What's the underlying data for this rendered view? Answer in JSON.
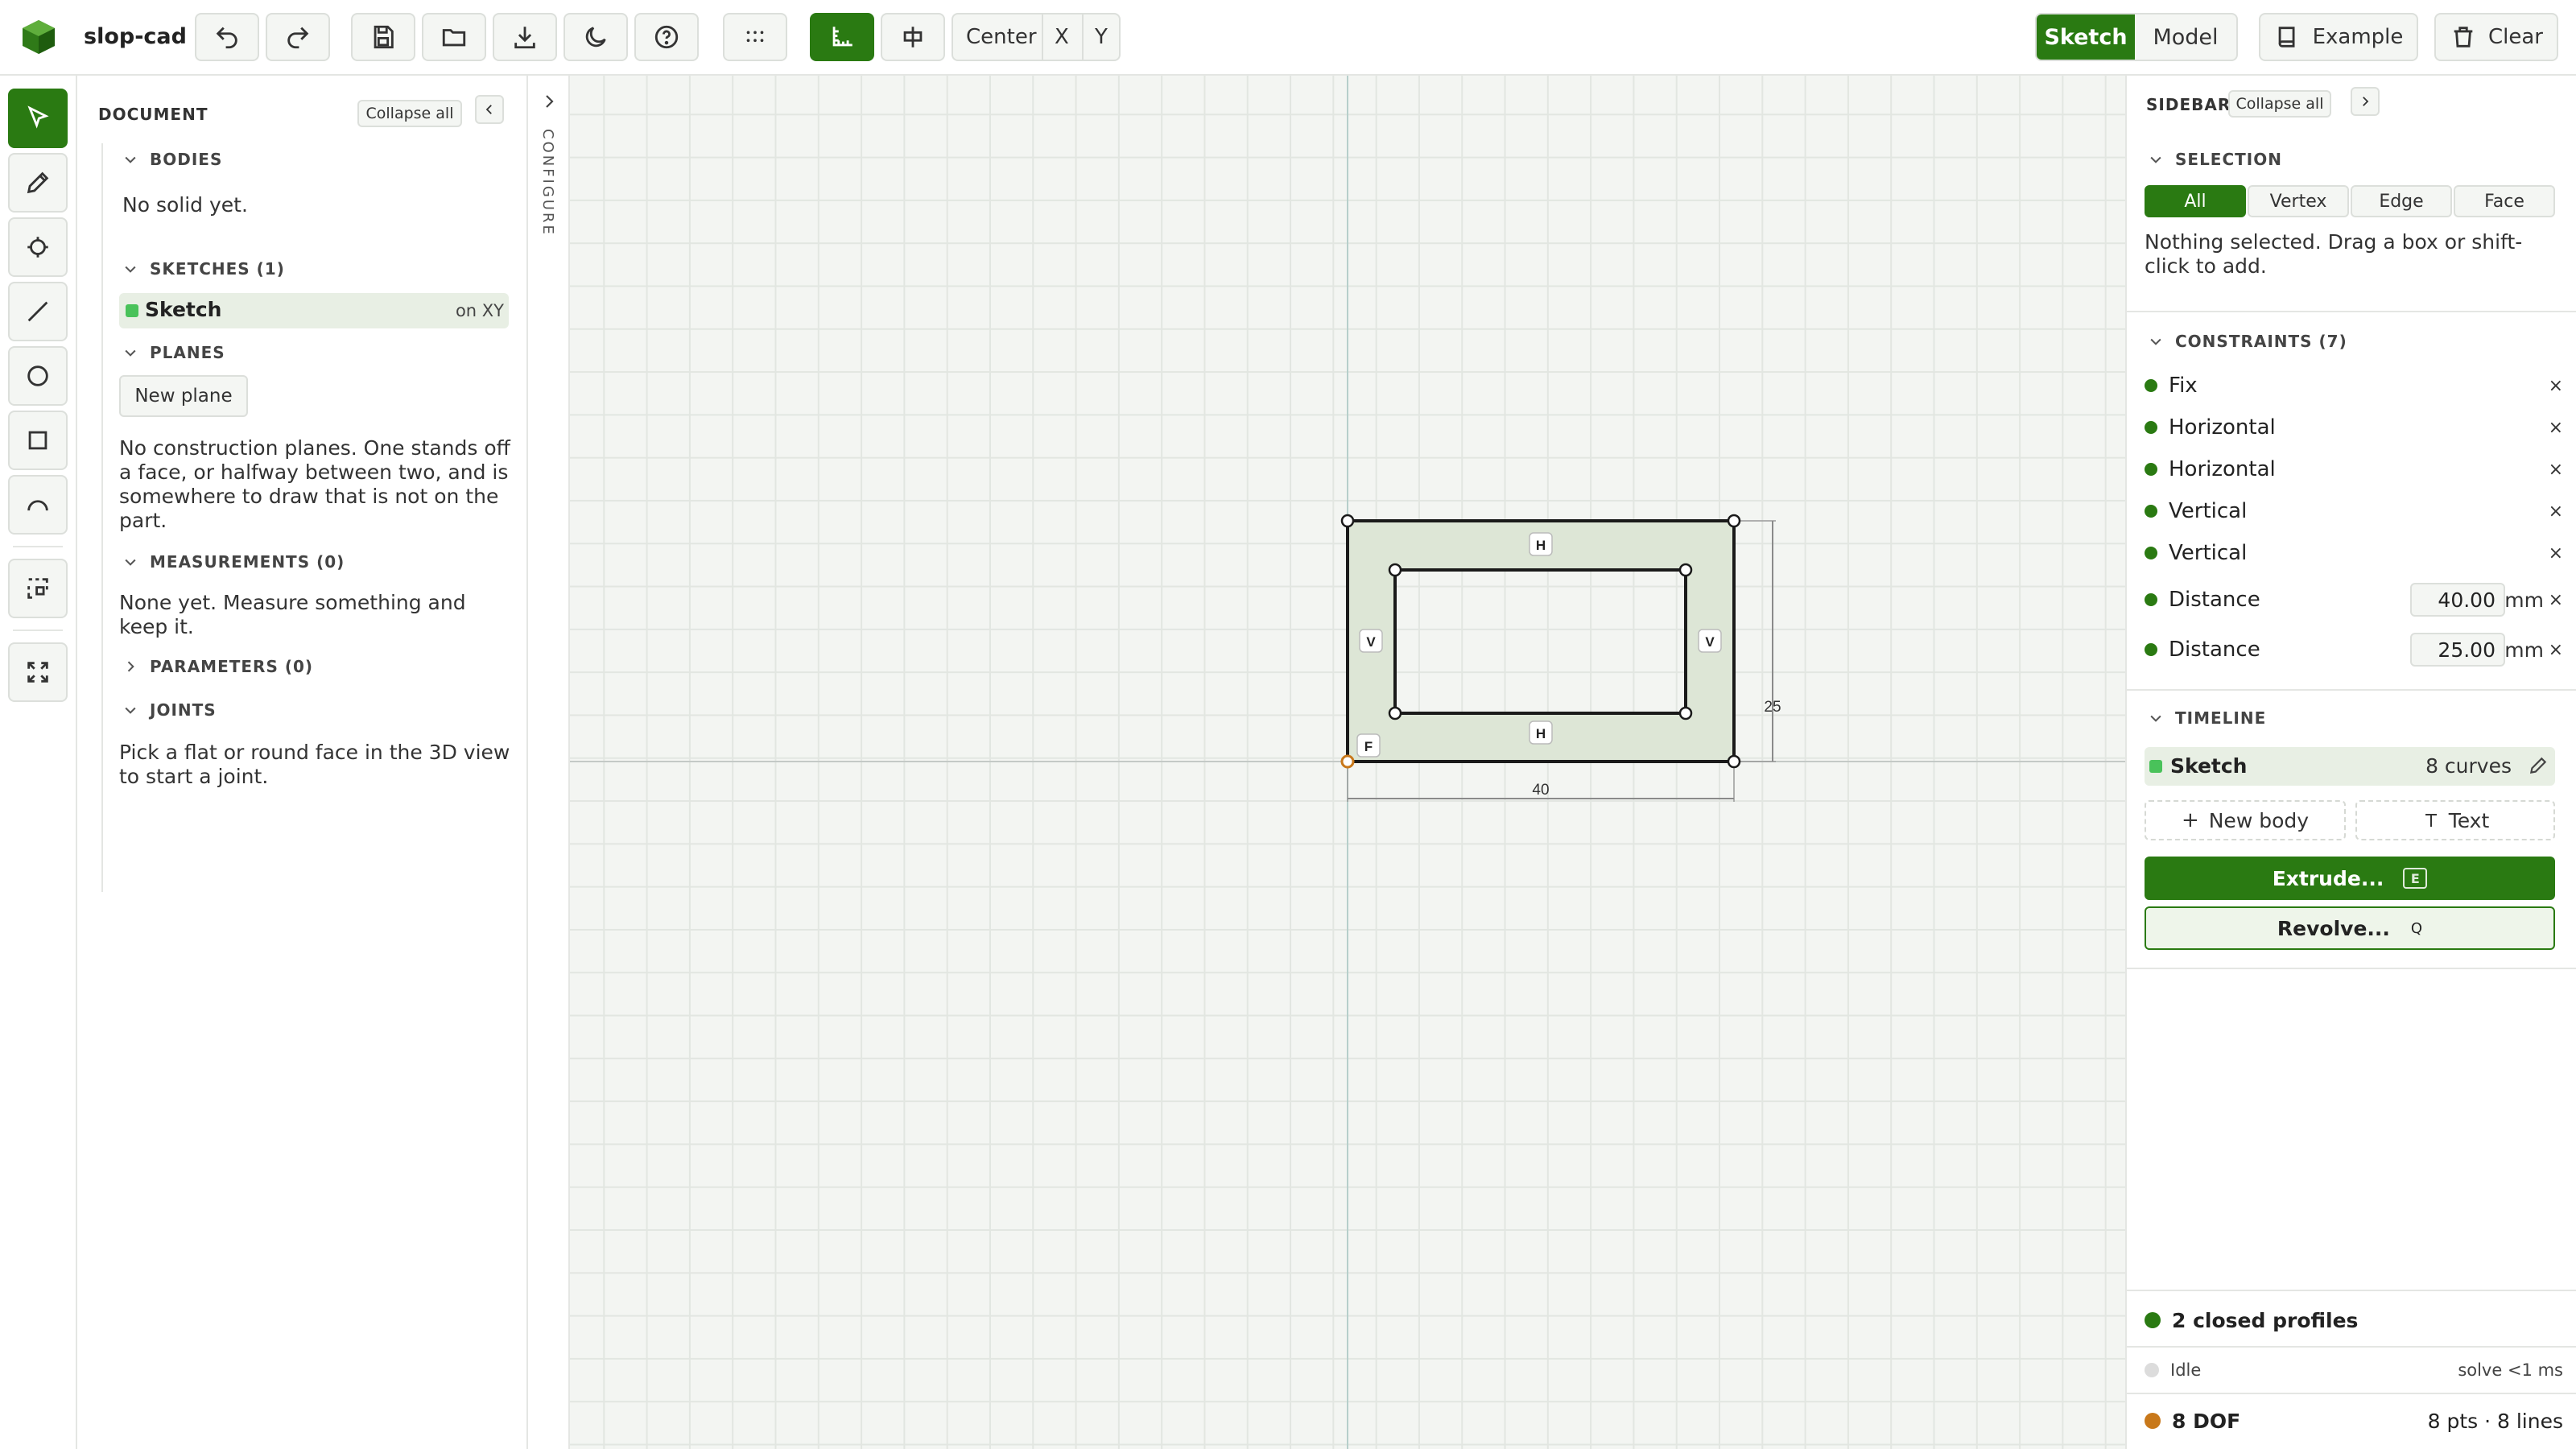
{
  "app": {
    "name": "slop-cad"
  },
  "toolbar": {
    "center_label": "Center",
    "x_label": "X",
    "y_label": "Y",
    "sketch_label": "Sketch",
    "model_label": "Model",
    "example_label": "Example",
    "clear_label": "Clear",
    "accent": "#2a7a12"
  },
  "document": {
    "title": "DOCUMENT",
    "collapse_all": "Collapse all",
    "bodies": {
      "header": "BODIES",
      "empty": "No solid yet."
    },
    "sketches": {
      "header": "SKETCHES (1)",
      "items": [
        {
          "name": "Sketch",
          "plane": "on XY"
        }
      ]
    },
    "planes": {
      "header": "PLANES",
      "new_plane": "New plane",
      "empty": "No construction planes. One stands off a face, or halfway between two, and is somewhere to draw that is not on the part."
    },
    "measurements": {
      "header": "MEASUREMENTS (0)",
      "empty": "None yet. Measure something and keep it."
    },
    "parameters": {
      "header": "PARAMETERS (0)"
    },
    "joints": {
      "header": "JOINTS",
      "empty": "Pick a flat or round face in the 3D view to start a joint."
    }
  },
  "configure": {
    "label": "CONFIGURE"
  },
  "canvas": {
    "sketch": {
      "outer_width_label": "40",
      "outer_height_label": "25",
      "tag_h": "H",
      "tag_v": "V",
      "tag_f": "F"
    }
  },
  "sidebar": {
    "title": "SIDEBAR",
    "collapse_all": "Collapse all",
    "selection": {
      "header": "SELECTION",
      "filters": [
        "All",
        "Vertex",
        "Edge",
        "Face"
      ],
      "active": "All",
      "hint": "Nothing selected. Drag a box or shift-click to add."
    },
    "constraints": {
      "header": "CONSTRAINTS (7)",
      "items": [
        {
          "name": "Fix"
        },
        {
          "name": "Horizontal"
        },
        {
          "name": "Horizontal"
        },
        {
          "name": "Vertical"
        },
        {
          "name": "Vertical"
        },
        {
          "name": "Distance",
          "value": "40.00",
          "unit": "mm"
        },
        {
          "name": "Distance",
          "value": "25.00",
          "unit": "mm"
        }
      ],
      "remove_glyph": "×"
    },
    "timeline": {
      "header": "TIMELINE",
      "item_name": "Sketch",
      "item_info": "8 curves",
      "new_body": "New body",
      "text": "Text",
      "extrude": "Extrude...",
      "extrude_key": "E",
      "revolve": "Revolve...",
      "revolve_key": "Q"
    },
    "status": {
      "profiles": "2 closed profiles",
      "idle": "Idle",
      "solve": "solve <1 ms",
      "dof": "8 DOF",
      "counts": "8 pts · 8 lines"
    }
  }
}
